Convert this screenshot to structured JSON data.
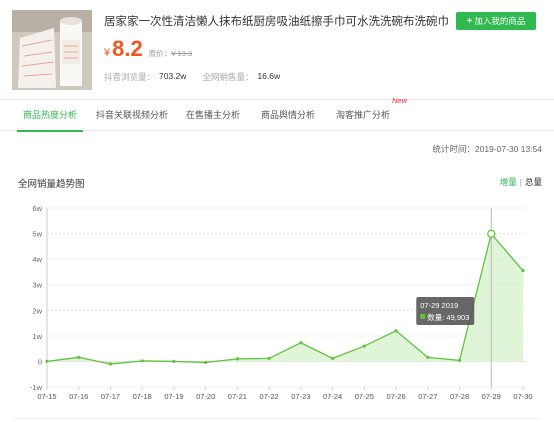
{
  "product": {
    "title": "居家家一次性清洁懒人抹布纸厨房吸油纸擦手巾可水洗洗碗布洗碗巾",
    "currency": "¥",
    "price": "8.2",
    "orig_label": "原价：",
    "orig_price": "¥ 13.3",
    "stats": [
      {
        "label": "抖音浏览量：",
        "value": "703.2w"
      },
      {
        "label": "全网销售量：",
        "value": "16.6w"
      }
    ],
    "add_button": "加入我的商品",
    "add_icon": "plus-icon"
  },
  "tabs": [
    {
      "label": "商品热度分析",
      "active": true
    },
    {
      "label": "抖音关联视频分析",
      "active": false
    },
    {
      "label": "在售播主分析",
      "active": false
    },
    {
      "label": "商品舆情分析",
      "active": false
    },
    {
      "label": "淘客推广分析",
      "active": false,
      "badge": "New"
    }
  ],
  "stat_time": "统计时间：2019-07-30 13:54",
  "section_title": "全网销量趋势图",
  "toggle": {
    "increment": "增量",
    "separator": "|",
    "total": "总量"
  },
  "colors": {
    "accent": "#2fb94f",
    "price": "#f0561d",
    "line": "#62c33f",
    "fill": "#d6f0cb",
    "badge": "#e22233"
  },
  "chart_data": {
    "type": "area",
    "title": "",
    "xlabel": "",
    "ylabel": "",
    "x": [
      "07-15",
      "07-16",
      "07-17",
      "07-18",
      "07-19",
      "07-20",
      "07-21",
      "07-22",
      "07-23",
      "07-24",
      "07-25",
      "07-26",
      "07-27",
      "07-28",
      "07-29",
      "07-30"
    ],
    "y_ticks": [
      "-1w",
      "0",
      "1w",
      "2w",
      "3w",
      "4w",
      "5w",
      "6w"
    ],
    "ylim": [
      -10000,
      60000
    ],
    "grid": true,
    "series": [
      {
        "values": [
          0,
          1600,
          -1000,
          200,
          0,
          -400,
          1000,
          1200,
          7300,
          1200,
          6000,
          12000,
          1600,
          400,
          49903,
          35500
        ]
      }
    ],
    "tooltip": {
      "date": "07-29 2019",
      "label": "数量: 49,903",
      "index": 14
    }
  }
}
